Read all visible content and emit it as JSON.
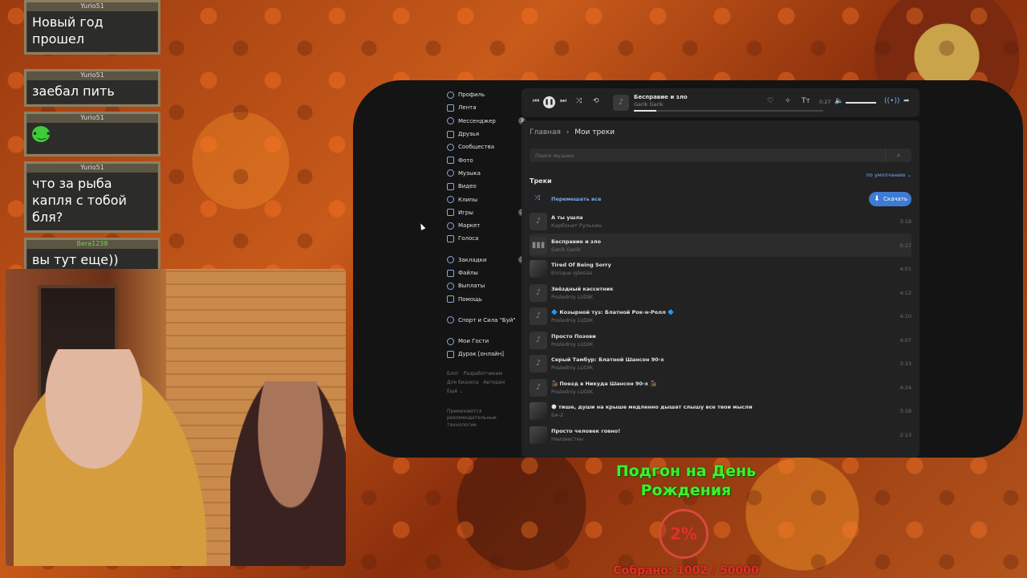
{
  "chat": [
    {
      "user": "Yurio51",
      "text": "Новый год прошел"
    },
    {
      "user": "Yurio51",
      "text": "заебал пить"
    },
    {
      "user": "Yurio51",
      "text": "",
      "sticker": "green-frog-sticker"
    },
    {
      "user": "Yurio51",
      "text": "что за рыба капля с тобой бля?"
    },
    {
      "user": "Bera1238",
      "text": "вы тут еще))"
    }
  ],
  "sidebar": {
    "items": [
      {
        "label": "Профиль",
        "icon": "profile-icon"
      },
      {
        "label": "Лента",
        "icon": "feed-icon"
      },
      {
        "label": "Мессенджер",
        "icon": "messenger-icon",
        "badge": "3"
      },
      {
        "label": "Друзья",
        "icon": "friends-icon"
      },
      {
        "label": "Сообщества",
        "icon": "communities-icon"
      },
      {
        "label": "Фото",
        "icon": "photo-icon"
      },
      {
        "label": "Музыка",
        "icon": "music-icon"
      },
      {
        "label": "Видео",
        "icon": "video-icon"
      },
      {
        "label": "Клипы",
        "icon": "clips-icon"
      },
      {
        "label": "Игры",
        "icon": "games-icon",
        "badge": "2"
      },
      {
        "label": "Маркет",
        "icon": "market-icon"
      },
      {
        "label": "Голоса",
        "icon": "votes-icon"
      }
    ],
    "items2": [
      {
        "label": "Закладки",
        "icon": "bookmarks-icon",
        "badge": "3"
      },
      {
        "label": "Файлы",
        "icon": "files-icon"
      },
      {
        "label": "Выплаты",
        "icon": "payments-icon"
      },
      {
        "label": "Помощь",
        "icon": "help-icon"
      }
    ],
    "items3": [
      {
        "label": "Спорт и Сила \"Буй\"",
        "icon": "group-icon"
      }
    ],
    "items4": [
      {
        "label": "Мои Гости",
        "icon": "guests-icon"
      },
      {
        "label": "Дурак [онлайн]",
        "icon": "game-app-icon"
      }
    ],
    "footer": [
      "Блог",
      "Разработчикам",
      "Для бизнеса",
      "Авторам",
      "Ещё ⌄"
    ],
    "note": "Применяются рекомендательные технологии"
  },
  "player": {
    "title": "Бесправие и зло",
    "artist": "Garik Garik",
    "time": "0:27",
    "progress": 0.12
  },
  "content": {
    "breadcrumb_root": "Главная",
    "breadcrumb_sep": "›",
    "breadcrumb_current": "Мои треки",
    "search_placeholder": "Поиск музыки",
    "tracks_label": "Треки",
    "sort_label": "по умолчанию ⌄",
    "shuffle_label": "Перемешать все",
    "download_label": "Скачать"
  },
  "tracks": [
    {
      "title": "А ты ушла",
      "artist": "Карбонат Рулькин",
      "duration": "3:18"
    },
    {
      "title": "Бесправие и зло",
      "artist": "Garik Garik",
      "duration": "0:27",
      "active": true
    },
    {
      "title": "Tired Of Being Sorry",
      "artist": "Enrique Iglesias",
      "duration": "4:01",
      "photo": true
    },
    {
      "title": "Звёздный кассетник",
      "artist": "Posledniy LUDIK",
      "duration": "4:12"
    },
    {
      "title": "🔷 Козырной туз: Блатной Рок-н-Ролл 🔷",
      "artist": "Posledniy LUDIK",
      "duration": "4:10"
    },
    {
      "title": "Просто Позови",
      "artist": "Posledniy LUDIK",
      "duration": "4:07"
    },
    {
      "title": "Серый Тамбур: Блатной Шансон 90-х",
      "artist": "Posledniy LUDIK",
      "duration": "3:33"
    },
    {
      "title": "🚂 Поезд в Никуда Шансон 90-х 🚂",
      "artist": "Posledniy LUDIK",
      "duration": "4:24"
    },
    {
      "title": "🌑 тише, души на крыше медленно дышат слышу все твои мысли",
      "artist": "Би-2",
      "duration": "3:18",
      "photo": true
    },
    {
      "title": "Просто человек говно!",
      "artist": "Неизвестен",
      "duration": "2:13",
      "photo": true
    }
  ],
  "goal": {
    "title": "Подгон на День Рождения",
    "percent": "2%",
    "sum": "Собрано: 1002 / 50000"
  }
}
